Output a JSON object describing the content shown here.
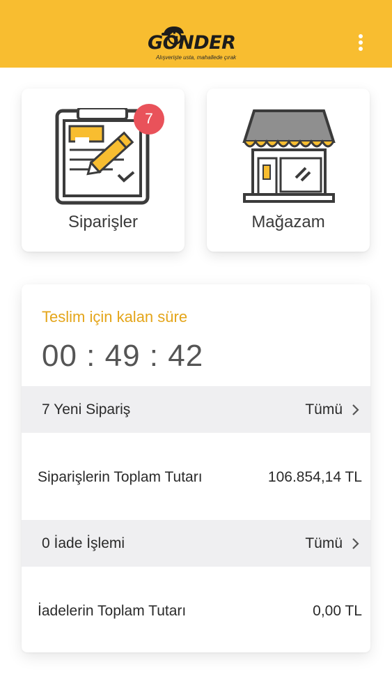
{
  "header": {
    "brand": "GÖNDER",
    "tagline": "Alışverişte usta, mahallede çırak",
    "colors": {
      "bar": "#f8bd30"
    },
    "menu_icon": "kebab-menu-icon"
  },
  "tiles": [
    {
      "label": "Siparişler",
      "icon": "clipboard-pencil-icon",
      "badge": "7"
    },
    {
      "label": "Mağazam",
      "icon": "storefront-icon"
    }
  ],
  "timer": {
    "caption": "Teslim için kalan süre",
    "value": "00 : 49 : 42",
    "caption_color": "#e4a51a"
  },
  "orders": {
    "header_label": "7 Yeni Sipariş",
    "all_label": "Tümü",
    "total_label": "Siparişlerin Toplam Tutarı",
    "total_value": "106.854,14 TL"
  },
  "returns": {
    "header_label": "0 İade İşlemi",
    "all_label": "Tümü",
    "total_label": "İadelerin Toplam Tutarı",
    "total_value": "0,00 TL"
  }
}
